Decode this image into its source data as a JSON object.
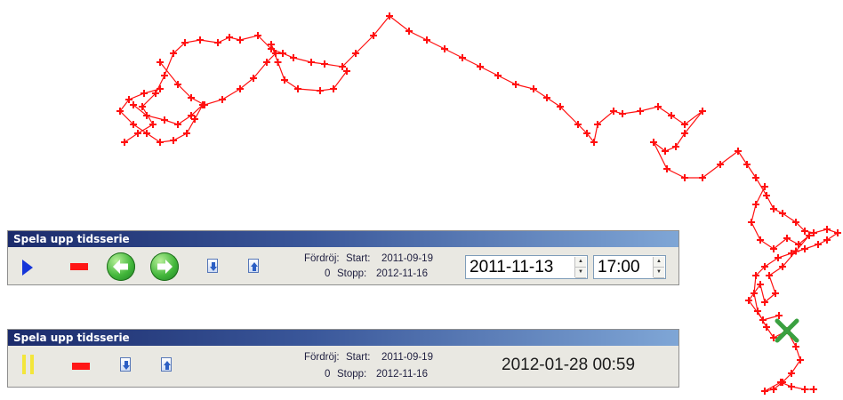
{
  "map": {
    "track_color": "#ff1010",
    "marker_color": "#3aa040",
    "current_marker_icon": "x-marker-icon"
  },
  "panel_playing": {
    "title": "Spela upp tidsserie",
    "delay_label": "Fördröj:",
    "delay_value": "0",
    "start_label": "Start:",
    "start_date": "2011-09-19",
    "stop_label": "Stopp:",
    "stop_date": "2012-11-16",
    "date_value": "2011-11-13",
    "time_value": "17:00",
    "icons": [
      "play-icon",
      "stop-icon",
      "back-arrow-icon",
      "forward-arrow-icon",
      "step-down-icon",
      "step-up-icon"
    ]
  },
  "panel_paused": {
    "title": "Spela upp tidsserie",
    "delay_label": "Fördröj:",
    "delay_value": "0",
    "start_label": "Start:",
    "start_date": "2011-09-19",
    "stop_label": "Stopp:",
    "stop_date": "2012-11-16",
    "current_datetime": "2012-01-28 00:59",
    "icons": [
      "pause-icon",
      "stop-icon",
      "step-down-icon",
      "step-up-icon"
    ]
  }
}
